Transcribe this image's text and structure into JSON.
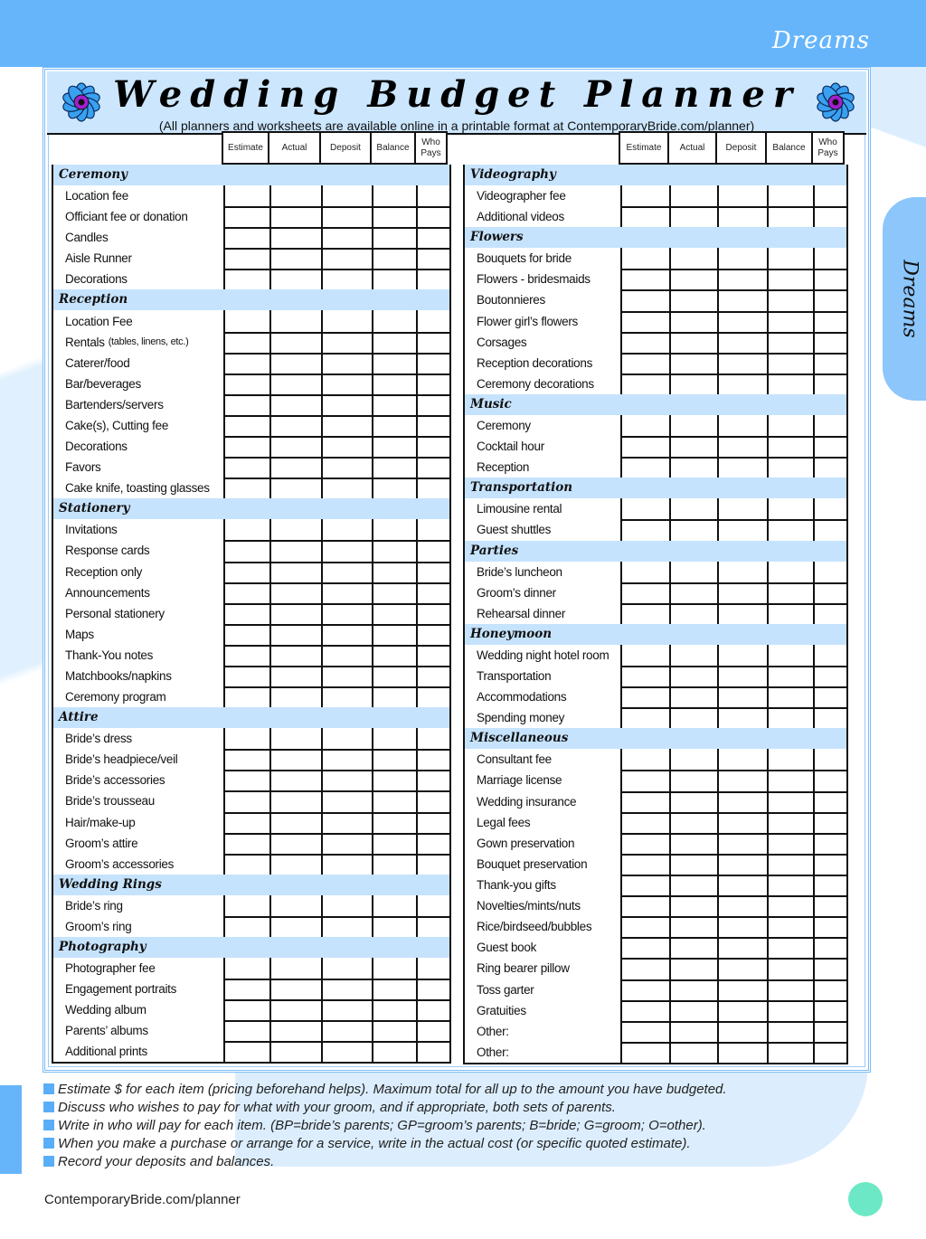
{
  "brand": {
    "script_label": "Dreams",
    "side_tab_label": "Dreams"
  },
  "header": {
    "title": "Wedding Budget Planner",
    "subtitle": "(All planners and worksheets are available online in a printable format at ContemporaryBride.com/planner)",
    "icon": "blue-flower-icon"
  },
  "columns": [
    "Estimate",
    "Actual",
    "Deposit",
    "Balance",
    "Who Pays"
  ],
  "colors": {
    "banner_blue": "#66b5fb",
    "section_band": "#c6e3fd",
    "title_band": "#cce6fd",
    "bullet_blue": "#5aaef8",
    "page_dot": "#6de8c6"
  },
  "left_sections": [
    {
      "title": "Ceremony",
      "items": [
        "Location fee",
        "Officiant fee or donation",
        "Candles",
        "Aisle Runner",
        "Decorations"
      ]
    },
    {
      "title": "Reception",
      "items": [
        "Location Fee",
        "Rentals",
        "Caterer/food",
        "Bar/beverages",
        "Bartenders/servers",
        "Cake(s), Cutting fee",
        "Decorations",
        "Favors",
        "Cake knife, toasting glasses"
      ],
      "item_notes": {
        "1": "(tables, linens, etc.)"
      }
    },
    {
      "title": "Stationery",
      "items": [
        "Invitations",
        "Response cards",
        "Reception only",
        "Announcements",
        "Personal stationery",
        "Maps",
        "Thank-You notes",
        "Matchbooks/napkins",
        "Ceremony program"
      ]
    },
    {
      "title": "Attire",
      "items": [
        "Bride’s dress",
        "Bride’s headpiece/veil",
        "Bride’s accessories",
        "Bride’s trousseau",
        "Hair/make-up",
        "Groom’s attire",
        "Groom’s accessories"
      ]
    },
    {
      "title": "Wedding Rings",
      "items": [
        "Bride’s ring",
        "Groom’s ring"
      ]
    },
    {
      "title": "Photography",
      "items": [
        "Photographer fee",
        "Engagement portraits",
        "Wedding album",
        "Parents’ albums",
        "Additional prints"
      ]
    }
  ],
  "right_sections": [
    {
      "title": "Videography",
      "items": [
        "Videographer fee",
        "Additional videos"
      ]
    },
    {
      "title": "Flowers",
      "items": [
        "Bouquets for bride",
        "Flowers - bridesmaids",
        "Boutonnieres",
        "Flower girl’s flowers",
        "Corsages",
        "Reception decorations",
        "Ceremony decorations"
      ]
    },
    {
      "title": "Music",
      "items": [
        "Ceremony",
        "Cocktail hour",
        "Reception"
      ]
    },
    {
      "title": "Transportation",
      "items": [
        "Limousine rental",
        "Guest shuttles"
      ]
    },
    {
      "title": "Parties",
      "items": [
        "Bride’s luncheon",
        "Groom’s dinner",
        "Rehearsal dinner"
      ]
    },
    {
      "title": "Honeymoon",
      "items": [
        "Wedding night hotel room",
        "Transportation",
        "Accommodations",
        "Spending money"
      ]
    },
    {
      "title": "Miscellaneous",
      "items": [
        "Consultant fee",
        "Marriage license",
        "Wedding insurance",
        "Legal fees",
        "Gown preservation",
        "Bouquet preservation",
        "Thank-you gifts",
        "Novelties/mints/nuts",
        "Rice/birdseed/bubbles",
        "Guest book",
        "Ring bearer pillow",
        "Toss garter",
        "Gratuities",
        "Other:",
        "Other:"
      ]
    }
  ],
  "notes": [
    "Estimate $ for each item (pricing beforehand helps). Maximum total for all up to the amount you have budgeted.",
    "Discuss who wishes to pay for what with your groom, and if appropriate, both sets of parents.",
    "Write in who will pay for each item. (BP=bride’s parents; GP=groom’s parents; B=bride; G=groom; O=other).",
    "When you make a purchase or arrange for a service, write in the actual cost (or specific quoted estimate).",
    "Record your deposits and balances."
  ],
  "footer": {
    "link": "ContemporaryBride.com/planner"
  }
}
